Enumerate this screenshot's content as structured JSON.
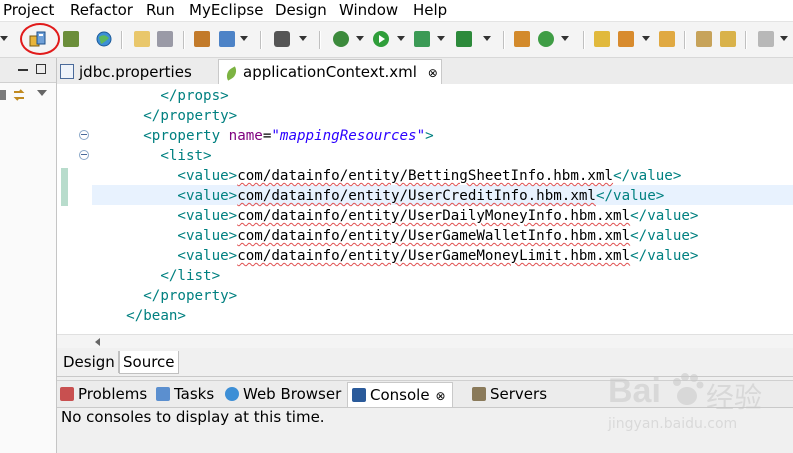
{
  "menu": [
    "Project",
    "Refactor",
    "Run",
    "MyEclipse",
    "Design",
    "Window",
    "Help"
  ],
  "editor_tabs": [
    {
      "label": "jdbc.properties",
      "icon": "properties-file-icon",
      "active": false
    },
    {
      "label": "applicationContext.xml",
      "icon": "spring-leaf-icon",
      "active": true,
      "close": "⊗"
    }
  ],
  "code": {
    "props_close": "</props>",
    "property_close": "</property>",
    "property_open_tag": "<property",
    "attr_name": "name",
    "attr_eq": "=",
    "attr_value": "\"mappingResources\"",
    "gt": ">",
    "list_open": "<list>",
    "value_open": "<value>",
    "value_close": "</value>",
    "mappings": [
      "com/datainfo/entity/BettingSheetInfo.hbm.xml",
      "com/datainfo/entity/UserCreditInfo.hbm.xml",
      "com/datainfo/entity/UserDailyMoneyInfo.hbm.xml",
      "com/datainfo/entity/UserGameWalletInfo.hbm.xml",
      "com/datainfo/entity/UserGameMoneyLimit.hbm.xml"
    ],
    "list_close": "</list>",
    "bean_close": "</bean>"
  },
  "design_tabs": [
    "Design",
    "Source"
  ],
  "views": [
    {
      "label": "Problems",
      "icon": "problems-icon"
    },
    {
      "label": "Tasks",
      "icon": "tasks-icon"
    },
    {
      "label": "Web Browser",
      "icon": "globe-icon"
    },
    {
      "label": "Console",
      "icon": "console-icon",
      "active": true,
      "close": "⊗"
    },
    {
      "label": "Servers",
      "icon": "servers-icon"
    }
  ],
  "console_message": "No consoles to display at this time.",
  "watermark": {
    "brand": "Bai",
    "brand_cn": "经验",
    "url": "jingyan.baidu.com"
  },
  "colors": {
    "tag": "#008080",
    "attr": "#7f007f",
    "attr_value": "#2a00ff",
    "highlight": "#e8f2fe",
    "annotation": "#e11b1b"
  }
}
